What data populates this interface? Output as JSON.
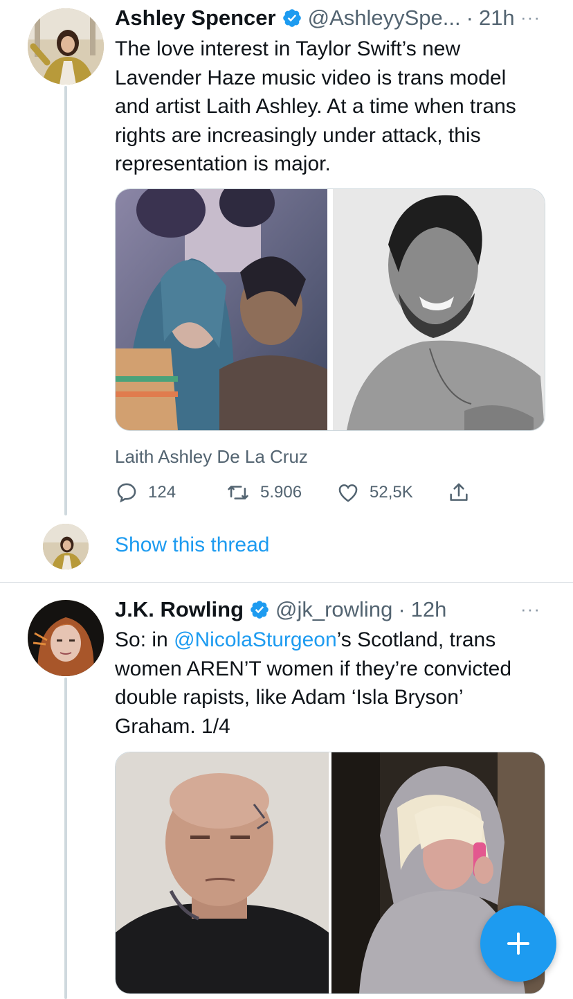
{
  "tweet1": {
    "name": "Ashley Spencer",
    "handle": "@AshleyySpe...",
    "time": "21h",
    "separator": "·",
    "text": "The love interest in Taylor Swift’s new Lavender Haze music video is trans model and artist Laith Ashley. At a time when trans rights are increasingly under attack, this representation is major.",
    "card_title": "Laith Ashley De La Cruz",
    "replies": "124",
    "retweets": "5.906",
    "likes": "52,5K",
    "more": "···"
  },
  "thread": {
    "show_label": "Show this thread"
  },
  "tweet2": {
    "name": "J.K. Rowling",
    "handle": "@jk_rowling",
    "time": "12h",
    "separator": "·",
    "text_prefix": "So: in ",
    "mention": "@NicolaSturgeon",
    "text_suffix": "’s Scotland, trans women AREN’T women if they’re convicted double rapists, like Adam ‘Isla Bryson’ Graham. 1/4",
    "more": "···"
  },
  "colors": {
    "accent": "#1d9bf0",
    "text": "#0f1419",
    "secondary": "#536471"
  },
  "icons": [
    "verified-badge-icon",
    "reply-icon",
    "retweet-icon",
    "like-icon",
    "share-icon",
    "more-icon",
    "compose-plus-icon"
  ]
}
